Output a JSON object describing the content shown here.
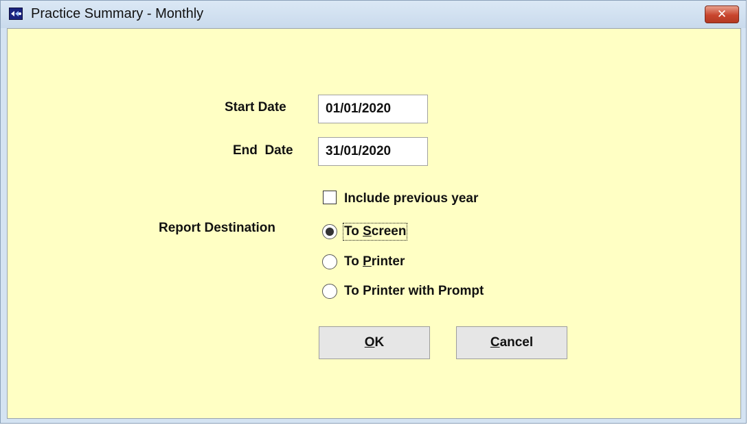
{
  "window": {
    "title": "Practice Summary - Monthly",
    "close_label": "✕"
  },
  "form": {
    "start_date_label": "Start Date",
    "start_date_value": "01/01/2020",
    "end_date_label": "End  Date",
    "end_date_value": "31/01/2020",
    "include_previous_year_label": "Include previous year",
    "include_previous_year_checked": false,
    "report_destination_label": "Report Destination",
    "destinations": [
      {
        "pre": "To ",
        "ul": "S",
        "post": "creen",
        "selected": true
      },
      {
        "pre": "To ",
        "ul": "P",
        "post": "rinter",
        "selected": false
      },
      {
        "pre": "To Printer with Prompt",
        "ul": "",
        "post": "",
        "selected": false
      }
    ]
  },
  "buttons": {
    "ok": {
      "ul": "O",
      "rest": "K"
    },
    "cancel": {
      "ul": "C",
      "rest": "ancel"
    }
  },
  "colors": {
    "client_bg": "#ffffc4",
    "titlebar": "#d4e3f2",
    "close_button": "#c8452e"
  }
}
